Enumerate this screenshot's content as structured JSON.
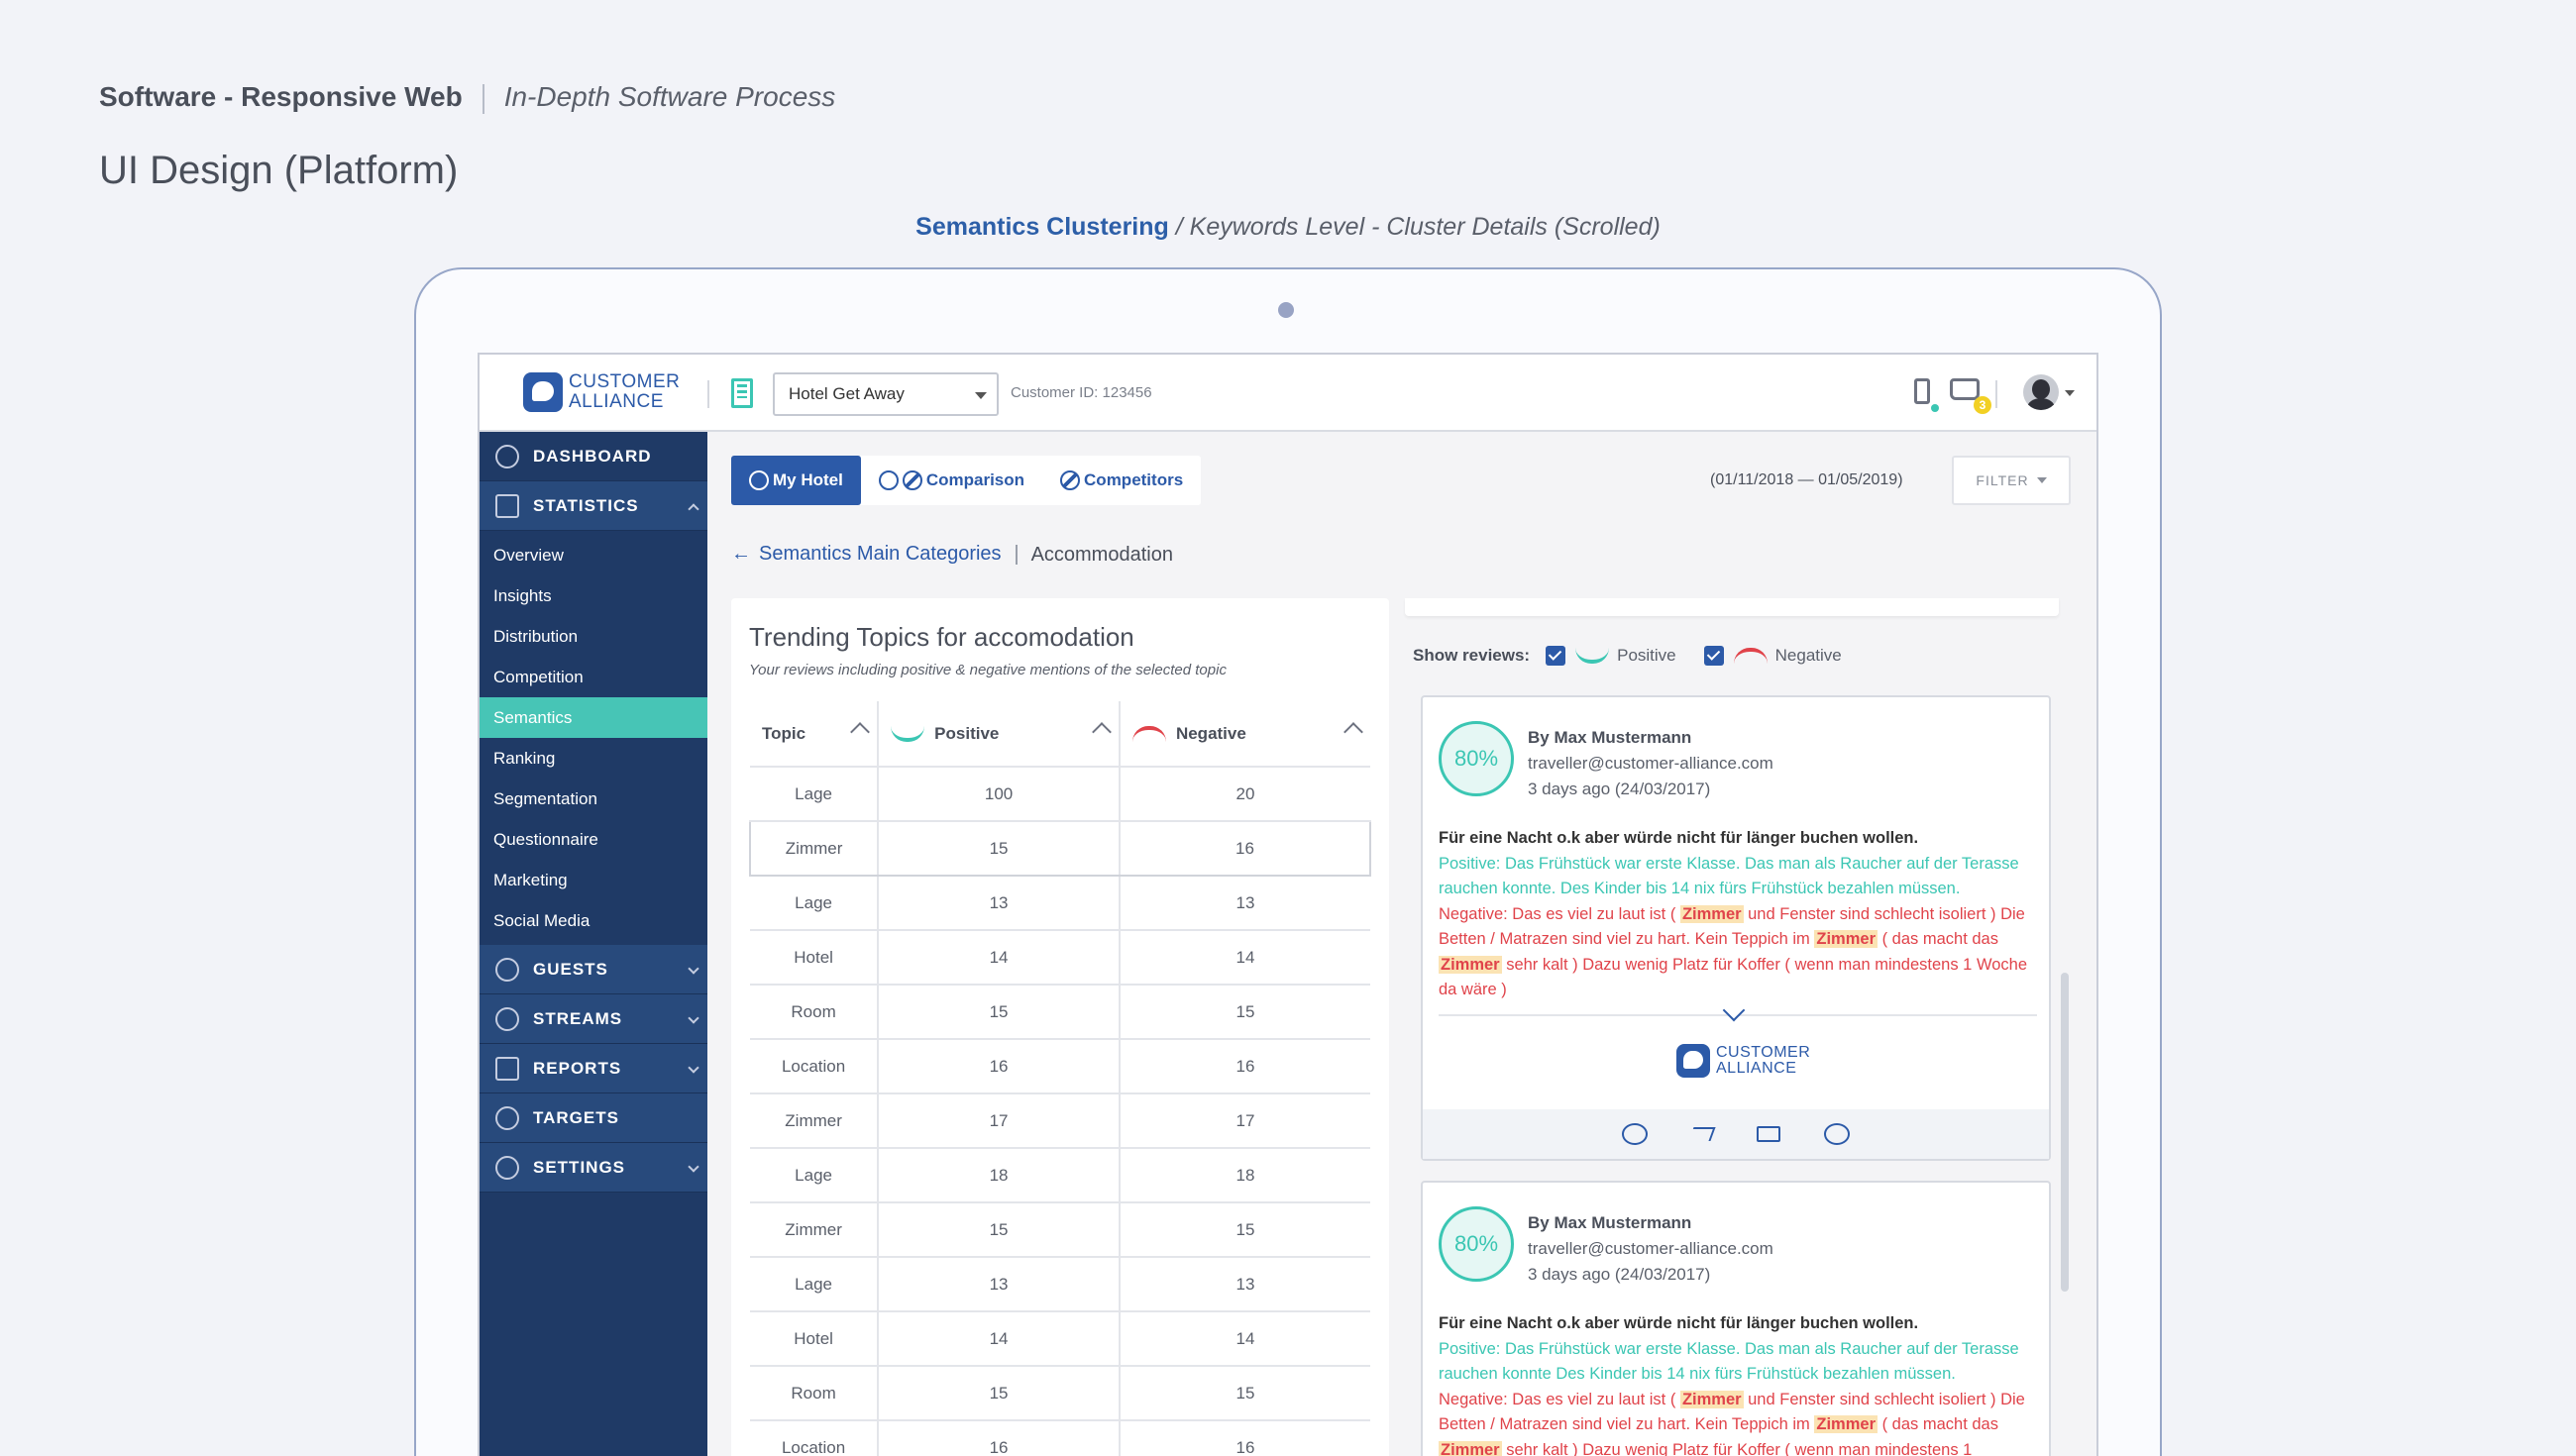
{
  "header": {
    "project": "Software - Responsive Web",
    "subtitle": "In-Depth Software Process",
    "title": "UI Design (Platform)",
    "caption_main": "Semantics Clustering",
    "caption_sep": "/",
    "caption_detail": "Keywords Level - Cluster Details (Scrolled)"
  },
  "topbar": {
    "logo_line1": "CUSTOMER",
    "logo_line2": "ALLIANCE",
    "hotel_select": "Hotel Get Away",
    "customer_id": "Customer ID: 123456",
    "notification_count": "3",
    "icons": [
      "phone-icon",
      "inbox-icon",
      "avatar"
    ]
  },
  "sidebar": {
    "dashboard": "DASHBOARD",
    "statistics": "STATISTICS",
    "sub_items": [
      "Overview",
      "Insights",
      "Distribution",
      "Competition",
      "Semantics",
      "Ranking",
      "Segmentation",
      "Questionnaire",
      "Marketing",
      "Social Media"
    ],
    "guests": "GUESTS",
    "streams": "STREAMS",
    "reports": "REPORTS",
    "targets": "TARGETS",
    "settings": "SETTINGS"
  },
  "tabs": [
    "My Hotel",
    "Comparison",
    "Competitors"
  ],
  "date_range": "(01/11/2018 — 01/05/2019)",
  "filter_label": "FILTER",
  "breadcrumb": {
    "back": "Semantics Main Categories",
    "current": "Accommodation"
  },
  "topics": {
    "title": "Trending Topics for accomodation",
    "subtitle": "Your reviews including positive & negative mentions of the selected topic",
    "columns": [
      "Topic",
      "Positive",
      "Negative"
    ],
    "rows": [
      [
        "Lage",
        "100",
        "20"
      ],
      [
        "Zimmer",
        "15",
        "16"
      ],
      [
        "Lage",
        "13",
        "13"
      ],
      [
        "Hotel",
        "14",
        "14"
      ],
      [
        "Room",
        "15",
        "15"
      ],
      [
        "Location",
        "16",
        "16"
      ],
      [
        "Zimmer",
        "17",
        "17"
      ],
      [
        "Lage",
        "18",
        "18"
      ],
      [
        "Zimmer",
        "15",
        "15"
      ],
      [
        "Lage",
        "13",
        "13"
      ],
      [
        "Hotel",
        "14",
        "14"
      ],
      [
        "Room",
        "15",
        "15"
      ],
      [
        "Location",
        "16",
        "16"
      ]
    ]
  },
  "reviews_filter": {
    "label": "Show reviews:",
    "positive": "Positive",
    "negative": "Negative"
  },
  "reviews": [
    {
      "score": "80%",
      "author": "By Max Mustermann",
      "email": "traveller@customer-alliance.com",
      "date": "3 days ago (24/03/2017)",
      "headline": "Für eine Nacht o.k aber würde nicht für länger buchen wollen.",
      "positive": "Positive: Das Frühstück war erste Klasse. Das man als Raucher auf der Terasse rauchen konnte. Des Kinder bis 14 nix fürs Frühstück bezahlen müssen.",
      "neg_a": "Negative: Das es viel zu laut ist ( ",
      "kw1": "Zimmer",
      "neg_b": " und Fenster sind schlecht isoliert ) Die Betten / Matrazen sind viel zu hart. Kein Teppich im ",
      "kw2": "Zimmer",
      "neg_c": " ( das macht das ",
      "kw3": "Zimmer",
      "neg_d": " sehr kalt ) Dazu wenig Platz für Koffer ( wenn man mindestens 1 Woche da wäre )"
    },
    {
      "score": "80%",
      "author": "By Max Mustermann",
      "email": "traveller@customer-alliance.com",
      "date": "3 days ago (24/03/2017)",
      "headline": "Für eine Nacht o.k aber würde nicht für länger buchen wollen.",
      "positive": "Positive: Das Frühstück war erste Klasse. Das man als Raucher auf der Terasse rauchen konnte Des Kinder bis 14 nix fürs Frühstück bezahlen müssen.",
      "neg_a": "Negative: Das es viel zu laut ist ( ",
      "kw1": "Zimmer",
      "neg_b": " und Fenster sind schlecht isoliert ) Die Betten / Matrazen sind viel zu hart. Kein Teppich im ",
      "kw2": "Zimmer",
      "neg_c": " ( das macht das ",
      "kw3": "Zimmer",
      "neg_d": " sehr kalt ) Dazu wenig Platz für Koffer ( wenn man mindestens 1"
    }
  ],
  "card_logo": {
    "line1": "CUSTOMER",
    "line2": "ALLIANCE"
  },
  "colors": {
    "brand_blue": "#2c5aa8",
    "sidebar": "#1f3a66",
    "teal": "#3bc6b3",
    "negative_red": "#e0434a",
    "keyword_highlight": "#fbe3b3"
  }
}
